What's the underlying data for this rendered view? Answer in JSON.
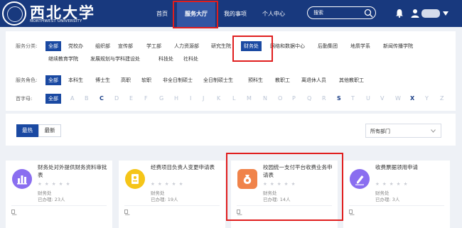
{
  "header": {
    "logo_text": "西北大学",
    "logo_subtext": "NORTHWEST UNIVERSITY",
    "nav": [
      "首页",
      "服务大厅",
      "我的事项",
      "个人中心"
    ],
    "active_nav": "服务大厅",
    "search_placeholder": "搜索",
    "icons": [
      "search-icon",
      "bell-icon",
      "user-icon",
      "chevron-down-icon"
    ],
    "brand_color": "#18397e"
  },
  "filters": {
    "category": {
      "label": "服务分类:",
      "items": [
        "全部",
        "党校办",
        "组织部",
        "宣传部",
        "学工部",
        "人力资源部",
        "研究生院",
        "财务处",
        "网络和数据中心",
        "后勤集团",
        "地质学系",
        "新闻传播学院",
        "继续教育学院",
        "发展规划与学科建设处",
        "科技处",
        "社科处"
      ],
      "selected": "财务处"
    },
    "role": {
      "label": "服务角色:",
      "items": [
        "全部",
        "本科生",
        "博士生",
        "高职",
        "软职",
        "非全日制硕士",
        "全日制硕士生",
        "预科生",
        "教职工",
        "离退休人员",
        "其他教职工"
      ],
      "selected": "全部"
    },
    "initial": {
      "label": "首字母:",
      "items": [
        "全部",
        "A",
        "B",
        "C",
        "D",
        "E",
        "F",
        "G",
        "H",
        "I",
        "J",
        "K",
        "L",
        "M",
        "N",
        "O",
        "P",
        "Q",
        "R",
        "S",
        "T",
        "U",
        "V",
        "W",
        "X",
        "Y",
        "Z"
      ],
      "highlighted": [
        "C",
        "S",
        "X"
      ],
      "selected": "全部"
    }
  },
  "toolbar": {
    "tabs": [
      "最热",
      "最新"
    ],
    "active_tab": "最热",
    "department_select": "所有部门"
  },
  "cards": [
    {
      "title": "财务处对外提供财务资料审批表",
      "department": "财务处",
      "count": "已办理: 23人",
      "icon": "building-icon",
      "color": "#8a6ef0"
    },
    {
      "title": "经费项目负责人变更申请表",
      "department": "财务处",
      "count": "已办理: 19人",
      "icon": "id-badge-icon",
      "color": "#f5c518"
    },
    {
      "title": "校园统一支付平台收费业务申请表",
      "department": "财务处",
      "count": "已办理: 14人",
      "icon": "money-bag-icon",
      "color": "#f0834a"
    },
    {
      "title": "收费票据领用申请",
      "department": "财务处",
      "count": "已办理: 3人",
      "icon": "edit-icon",
      "color": "#8a6ef0"
    }
  ],
  "rating": "★ ★ ★ ★ ★"
}
